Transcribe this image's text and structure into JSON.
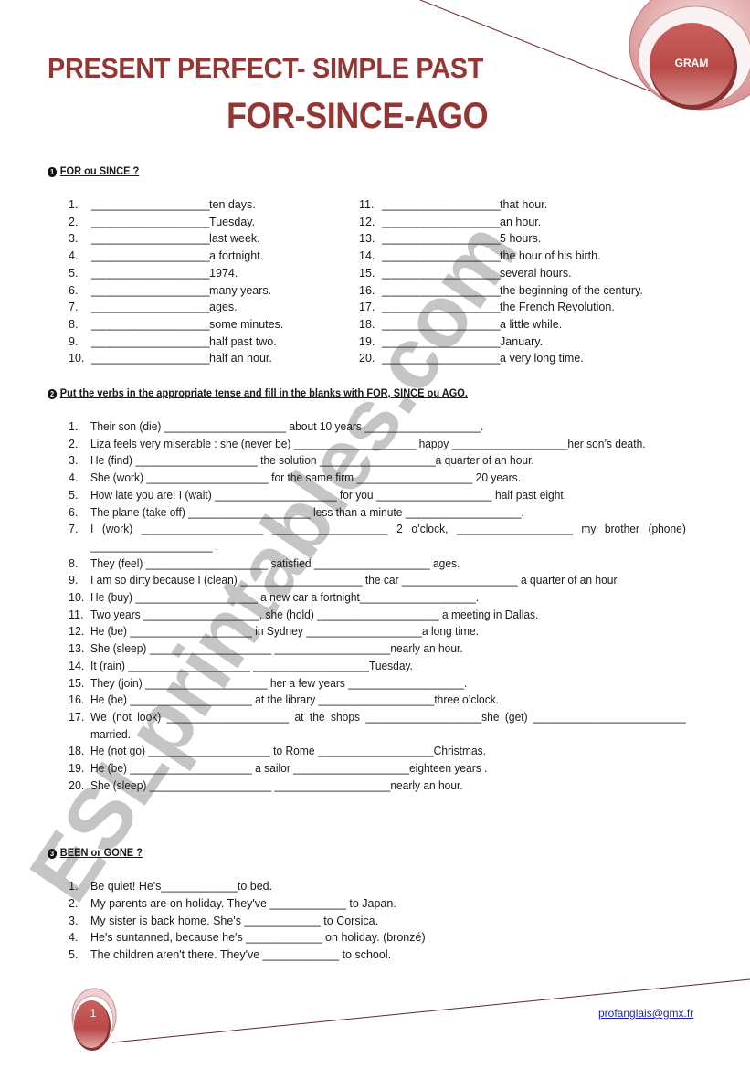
{
  "header": {
    "title_line1": "PRESENT PERFECT- SIMPLE PAST",
    "title_line2": "FOR-SINCE-AGO",
    "badge_label": "GRAM"
  },
  "colors": {
    "title": "#943634",
    "badge": "#c0504d",
    "link": "#1f1fb0"
  },
  "exercise1": {
    "number": "1",
    "heading": "FOR ou SINCE ?",
    "blank": "____________________",
    "left": [
      {
        "n": "1.",
        "text": "ten days."
      },
      {
        "n": "2.",
        "text": "Tuesday."
      },
      {
        "n": "3.",
        "text": "last week."
      },
      {
        "n": "4.",
        "text": "a fortnight."
      },
      {
        "n": "5.",
        "text": " 1974."
      },
      {
        "n": "6.",
        "text": " many years."
      },
      {
        "n": "7.",
        "text": "ages."
      },
      {
        "n": "8.",
        "text": " some minutes."
      },
      {
        "n": "9.",
        "text": "half past two."
      },
      {
        "n": "10.",
        "text": "half an hour."
      }
    ],
    "right": [
      {
        "n": "11.",
        "text": "that hour."
      },
      {
        "n": "12.",
        "text": "an hour."
      },
      {
        "n": "13.",
        "text": " 5 hours."
      },
      {
        "n": "14.",
        "text": "the hour of his birth."
      },
      {
        "n": "15.",
        "text": "several hours."
      },
      {
        "n": "16.",
        "text": "the beginning of the century."
      },
      {
        "n": "17.",
        "text": "the French Revolution."
      },
      {
        "n": "18.",
        "text": "a little while."
      },
      {
        "n": "19.",
        "text": "January."
      },
      {
        "n": "20.",
        "text": "a very long time."
      }
    ]
  },
  "exercise2": {
    "number": "2",
    "heading": "Put the verbs in the appropriate tense and fill in the blanks with  FOR, SINCE ou AGO.",
    "items": [
      {
        "n": "1.",
        "text": "Their son (die) ____________________ about 10 years ___________________."
      },
      {
        "n": "2.",
        "text": "Liza feels very miserable : she (never be) ____________________ happy ___________________her son’s death."
      },
      {
        "n": "3.",
        "text": "He (find) ____________________ the solution ___________________a quarter of an hour."
      },
      {
        "n": "4.",
        "text": "She (work) ____________________ for the same firm ___________________ 20 years."
      },
      {
        "n": "5.",
        "text": "How late you are! I (wait) ____________________ for you ___________________ half past eight."
      },
      {
        "n": "6.",
        "text": "The plane (take off) ____________________ less than a minute ___________________."
      },
      {
        "n": "7.",
        "text": "I (work) ____________________ ___________________ 2 o’clock, ___________________ my brother (phone) ____________________ ."
      },
      {
        "n": "8.",
        "text": "They (feel) ____________________ satisfied ___________________ ages."
      },
      {
        "n": "9.",
        "text": "I am so dirty because I (clean) ____________________ the car ___________________ a quarter of an hour."
      },
      {
        "n": "10.",
        "text": "He (buy) ____________________ a new car a fortnight___________________."
      },
      {
        "n": "11.",
        "text": "Two years ___________________, she (hold) ____________________ a meeting in Dallas."
      },
      {
        "n": "12.",
        "text": "He (be) ____________________ in Sydney ___________________a long time."
      },
      {
        "n": "13.",
        "text": "She (sleep) ____________________ ___________________nearly an hour."
      },
      {
        "n": "14.",
        "text": "It (rain) ____________________ ___________________Tuesday."
      },
      {
        "n": "15.",
        "text": "They (join) ____________________ her a few years ___________________."
      },
      {
        "n": "16.",
        "text": "He (be) ____________________ at the library ___________________three o’clock."
      },
      {
        "n": "17.",
        "text": "We (not look) ____________________ at the shops ___________________she (get) _________________________ married."
      },
      {
        "n": "18.",
        "text": "He (not go) ____________________ to Rome ___________________Christmas."
      },
      {
        "n": "19.",
        "text": "He (be) ____________________ a sailor ___________________eighteen years ."
      },
      {
        "n": "20.",
        "text": "She (sleep) ____________________ ___________________nearly an hour."
      }
    ]
  },
  "exercise3": {
    "number": "3",
    "heading": "BEEN or GONE ?",
    "items": [
      {
        "n": "1.",
        "text": "Be quiet! He's____________to bed."
      },
      {
        "n": "2.",
        "text": "My parents are on holiday. They've ____________ to Japan."
      },
      {
        "n": "3.",
        "text": "My sister is back home. She's ____________ to Corsica."
      },
      {
        "n": "4.",
        "text": "He's suntanned, because he's ____________ on holiday. (bronzé)"
      },
      {
        "n": "5.",
        "text": "The children aren't there. They've ____________ to school."
      }
    ]
  },
  "watermark": "ESLprintables.com",
  "footer": {
    "page_number": "1",
    "email": "profanglais@gmx.fr"
  }
}
